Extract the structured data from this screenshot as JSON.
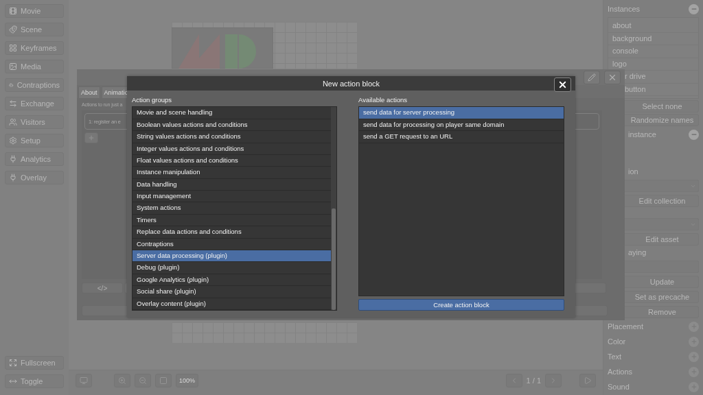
{
  "sidebar": {
    "items": [
      {
        "label": "Movie"
      },
      {
        "label": "Scene"
      },
      {
        "label": "Keyframes"
      },
      {
        "label": "Media"
      },
      {
        "label": "Contraptions"
      },
      {
        "label": "Exchange"
      },
      {
        "label": "Visitors"
      },
      {
        "label": "Setup"
      },
      {
        "label": "Analytics"
      },
      {
        "label": "Overlay"
      }
    ],
    "bottom_items": [
      {
        "label": "Fullscreen"
      },
      {
        "label": "Toggle"
      }
    ]
  },
  "editor_window": {
    "tabs": [
      {
        "label": "About",
        "selected": false
      },
      {
        "label": "Animatio",
        "selected": false
      }
    ],
    "caption": "Actions to run just a",
    "action_item": "1: register an e",
    "code_button": "</>"
  },
  "toolbar": {
    "zoom": "100%",
    "page": "1 / 1"
  },
  "right_panel": {
    "sections": [
      {
        "title": "Instances",
        "expanded": true,
        "rows": [
          {
            "kind": "list",
            "items": [
              "about",
              "background",
              "console",
              "logo",
              "r drive",
              "button"
            ]
          },
          {
            "kind": "button",
            "label": "Select none"
          },
          {
            "kind": "button",
            "label": "Randomize names"
          }
        ]
      },
      {
        "title": "instance",
        "expanded": true,
        "rows": [
          {
            "kind": "label",
            "text": "ion"
          },
          {
            "kind": "select"
          },
          {
            "kind": "button",
            "label": "Edit collection"
          },
          {
            "kind": "select"
          },
          {
            "kind": "button",
            "label": "Edit asset"
          },
          {
            "kind": "label",
            "text": "aying"
          },
          {
            "kind": "input"
          },
          {
            "kind": "button",
            "label": "Update"
          },
          {
            "kind": "button",
            "label": "Set as precache"
          },
          {
            "kind": "button",
            "label": "Remove"
          }
        ]
      },
      {
        "title": "Placement",
        "expanded": false
      },
      {
        "title": "Color",
        "expanded": false
      },
      {
        "title": "Text",
        "expanded": false
      },
      {
        "title": "Actions",
        "expanded": false
      },
      {
        "title": "Sound",
        "expanded": false
      }
    ]
  },
  "dialog": {
    "title": "New action block",
    "groups_label": "Action groups",
    "groups": [
      {
        "label": "Movie and scene handling",
        "selected": false
      },
      {
        "label": "Boolean values actions and conditions",
        "selected": false
      },
      {
        "label": "String values actions and conditions",
        "selected": false
      },
      {
        "label": "Integer values actions and conditions",
        "selected": false
      },
      {
        "label": "Float values actions and conditions",
        "selected": false
      },
      {
        "label": "Instance manipulation",
        "selected": false
      },
      {
        "label": "Data handling",
        "selected": false
      },
      {
        "label": "Input management",
        "selected": false
      },
      {
        "label": "System actions",
        "selected": false
      },
      {
        "label": "Timers",
        "selected": false
      },
      {
        "label": "Replace data actions and conditions",
        "selected": false
      },
      {
        "label": "Contraptions",
        "selected": false
      },
      {
        "label": "Server data processing (plugin)",
        "selected": true
      },
      {
        "label": "Debug (plugin)",
        "selected": false
      },
      {
        "label": "Google Analytics (plugin)",
        "selected": false
      },
      {
        "label": "Social share (plugin)",
        "selected": false
      },
      {
        "label": "Overlay content (plugin)",
        "selected": false
      }
    ],
    "actions_label": "Available actions",
    "actions": [
      {
        "label": "send data for server processing",
        "selected": true
      },
      {
        "label": "send data for processing on player same domain",
        "selected": false
      },
      {
        "label": "send a GET request to an URL",
        "selected": false
      }
    ],
    "create_button": "Create action block"
  }
}
